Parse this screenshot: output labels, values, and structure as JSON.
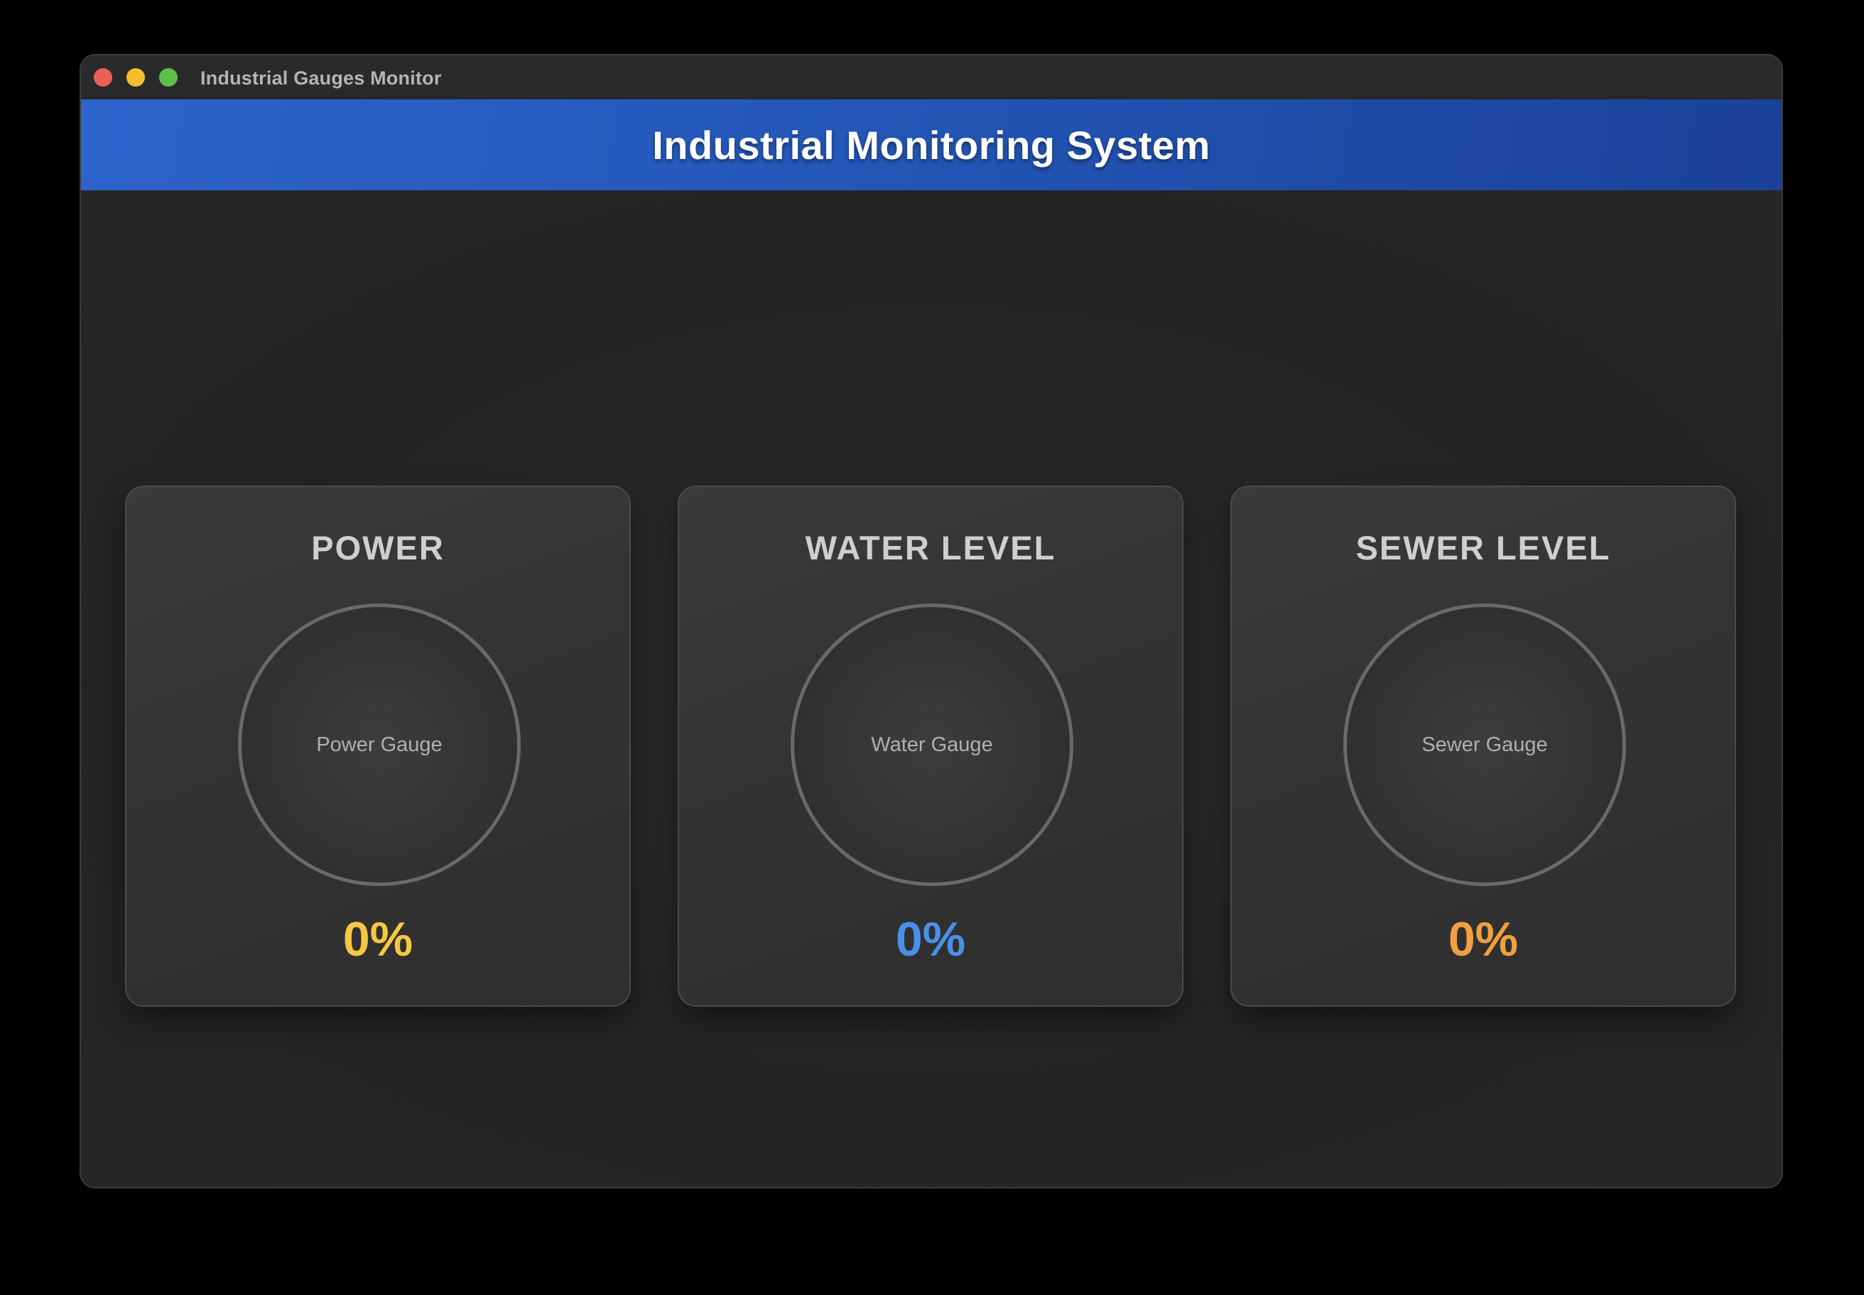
{
  "window": {
    "title": "Industrial Gauges Monitor"
  },
  "header": {
    "title": "Industrial Monitoring System"
  },
  "gauges": [
    {
      "title": "POWER",
      "gauge_label": "Power Gauge",
      "value": "0%",
      "color": "#f5c842"
    },
    {
      "title": "WATER LEVEL",
      "gauge_label": "Water Gauge",
      "value": "0%",
      "color": "#4a90e8"
    },
    {
      "title": "SEWER LEVEL",
      "gauge_label": "Sewer Gauge",
      "value": "0%",
      "color": "#f0a040"
    }
  ],
  "colors": {
    "header_blue": "#2457b8",
    "background": "#262626",
    "card": "#333333"
  }
}
